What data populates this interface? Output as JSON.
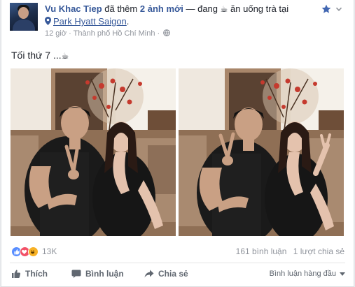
{
  "post": {
    "author": "Vu Khac Tiep",
    "action_text": "đã thêm",
    "photo_count_link": "2 ảnh mới",
    "activity_text": "— đang",
    "activity_icon": "coffee-cup-icon",
    "activity_rest": "ăn uống trà tại",
    "location": "Park Hyatt Saigon",
    "location_suffix": ".",
    "time": "12 giờ",
    "meta_separator": "·",
    "city": "Thành phố Hồ Chí Minh",
    "meta_separator2": "·",
    "message": "Tối thứ 7 ...",
    "message_icon": "coffee-cup-icon"
  },
  "stats": {
    "reaction_count": "13K",
    "comments": "161 bình luận",
    "shares": "1 lượt chia sẻ"
  },
  "actions": {
    "like": "Thích",
    "comment": "Bình luận",
    "share": "Chia sẻ",
    "sort": "Bình luận hàng đầu"
  },
  "colors": {
    "link": "#365899",
    "like_reaction": "#598eff",
    "love_reaction": "#f25268",
    "haha_reaction": "#f7b125",
    "muted": "#90949c"
  }
}
